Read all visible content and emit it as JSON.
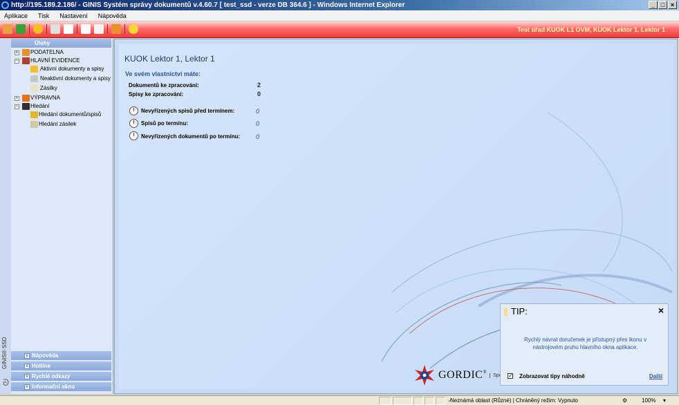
{
  "window": {
    "title": "http://195.189.2.186/ - GINIS Systém správy dokumentů v.4.60.7 [ test_ssd - verze DB 364.6 ] - Windows Internet Explorer"
  },
  "menu": [
    "Aplikace",
    "Tisk",
    "Nastavení",
    "Nápověda"
  ],
  "toolbar": {
    "org_user": "Test úřad KUOK L1 OVM, KUOK Lektor 1, Lektor 1",
    "icons": [
      "user-icon",
      "exit-icon",
      "info-icon",
      "refresh-icon",
      "find-icon",
      "new-document-icon",
      "document-icon",
      "import-icon",
      "favorites-icon"
    ]
  },
  "sidebar": {
    "tasks_header": "Úlohy",
    "tree": [
      {
        "label": "PODATELNA",
        "level": 0,
        "expander": "+",
        "icon": "mailbox-icon"
      },
      {
        "label": "HLAVNÍ EVIDENCE",
        "level": 0,
        "expander": "−",
        "icon": "book-icon"
      },
      {
        "label": "Aktivní dokumenty a spisy",
        "level": 1,
        "icon": "folder-icon"
      },
      {
        "label": "Neaktivní dokumenty a spisy",
        "level": 1,
        "icon": "folder-gray-icon"
      },
      {
        "label": "Zásilky",
        "level": 1,
        "icon": "envelope-icon"
      },
      {
        "label": "VÝPRAVNA",
        "level": 0,
        "expander": "+",
        "icon": "dispatch-icon"
      },
      {
        "label": "Hledání",
        "level": 0,
        "expander": "−",
        "icon": "binoculars-icon"
      },
      {
        "label": "Hledání dokumentů/spisů",
        "level": 1,
        "icon": "search-documents-icon"
      },
      {
        "label": "Hledání zásilek",
        "level": 1,
        "icon": "search-parcels-icon"
      }
    ],
    "brand": "GINIS® SSD",
    "accordion": [
      "Nápověda",
      "Hotline",
      "Rychlé odkazy",
      "Informační okno"
    ]
  },
  "main": {
    "headline": "KUOK Lektor 1, Lektor 1",
    "subhead": "Ve svém vlastnictví máte:",
    "stats": [
      {
        "label": "Dokumentů ke zpracování:",
        "value": "2"
      },
      {
        "label": "Spisy ke zpracování:",
        "value": "0"
      }
    ],
    "deadlines": [
      {
        "label": "Nevyřízených spisů před termínem:",
        "value": "0"
      },
      {
        "label": "Spisů po termínu:",
        "value": "0"
      },
      {
        "label": "Nevyřízených dokumentů po termínu:",
        "value": "0"
      }
    ]
  },
  "tip": {
    "title": "TIP:",
    "close": "×",
    "text": "Rychlý návrat doručenek je přístupný přes ikonu v nástrojovém pruhu hlavního okna aplikace.",
    "checkbox_label": "Zobrazovat tipy náhodně",
    "checkbox_checked": true,
    "next": "Další"
  },
  "logo": {
    "name": "GORDIC",
    "reg": "®",
    "tagline": "Spe"
  },
  "statusbar": {
    "zone": "Neznámá oblast (Různé) | Chráněný režim: Vypnuto",
    "zoom": "100%"
  }
}
